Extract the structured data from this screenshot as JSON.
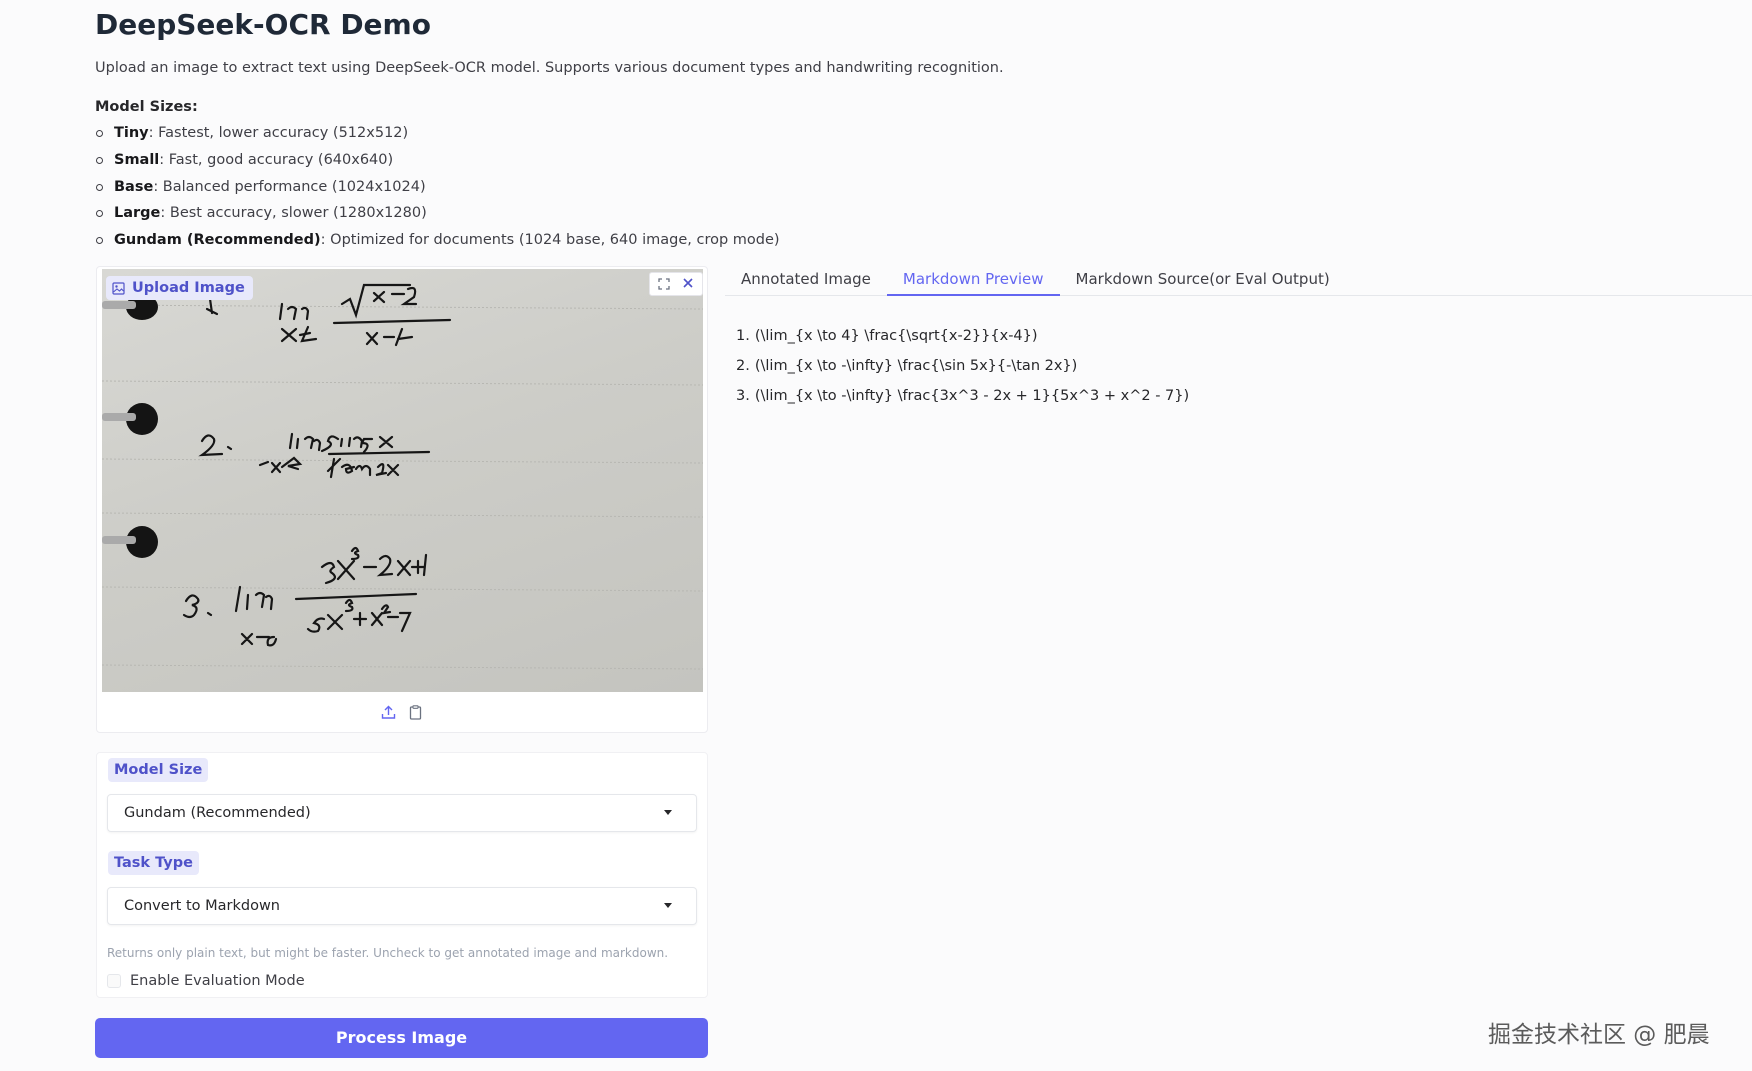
{
  "header": {
    "title": "DeepSeek-OCR Demo",
    "description": "Upload an image to extract text using DeepSeek-OCR model. Supports various document types and handwriting recognition."
  },
  "model_sizes": {
    "heading": "Model Sizes:",
    "items": [
      {
        "name": "Tiny",
        "desc": ": Fastest, lower accuracy (512x512)"
      },
      {
        "name": "Small",
        "desc": ": Fast, good accuracy (640x640)"
      },
      {
        "name": "Base",
        "desc": ": Balanced performance (1024x1024)"
      },
      {
        "name": "Large",
        "desc": ": Best accuracy, slower (1280x1280)"
      },
      {
        "name": "Gundam (Recommended)",
        "desc": ": Optimized for documents (1024 base, 640 image, crop mode)"
      }
    ]
  },
  "upload": {
    "label": "Upload Image",
    "icons": [
      "fullscreen-icon",
      "close-icon",
      "upload-icon",
      "clipboard-icon"
    ]
  },
  "settings": {
    "model_size_label": "Model Size",
    "model_size_value": "Gundam (Recommended)",
    "task_type_label": "Task Type",
    "task_type_value": "Convert to Markdown",
    "hint": "Returns only plain text, but might be faster. Uncheck to get annotated image and markdown.",
    "eval_mode_label": "Enable Evaluation Mode",
    "eval_mode_checked": false
  },
  "process_button": "Process Image",
  "tabs": [
    {
      "label": "Annotated Image",
      "active": false
    },
    {
      "label": "Markdown Preview",
      "active": true
    },
    {
      "label": "Markdown Source(or Eval Output)",
      "active": false
    }
  ],
  "markdown_preview": [
    {
      "num": "1.",
      "text": "(\\lim_{x \\to 4} \\frac{\\sqrt{x-2}}{x-4})"
    },
    {
      "num": "2.",
      "text": "(\\lim_{x \\to -\\infty} \\frac{\\sin 5x}{-\\tan 2x})"
    },
    {
      "num": "3.",
      "text": "(\\lim_{x \\to -\\infty} \\frac{3x^3 - 2x + 1}{5x^3 + x^2 - 7})"
    }
  ],
  "watermark": "掘金技术社区 @ 肥晨",
  "colors": {
    "accent": "#6366f1",
    "badge_bg": "#e8e9fb",
    "badge_text": "#4f52c9"
  }
}
